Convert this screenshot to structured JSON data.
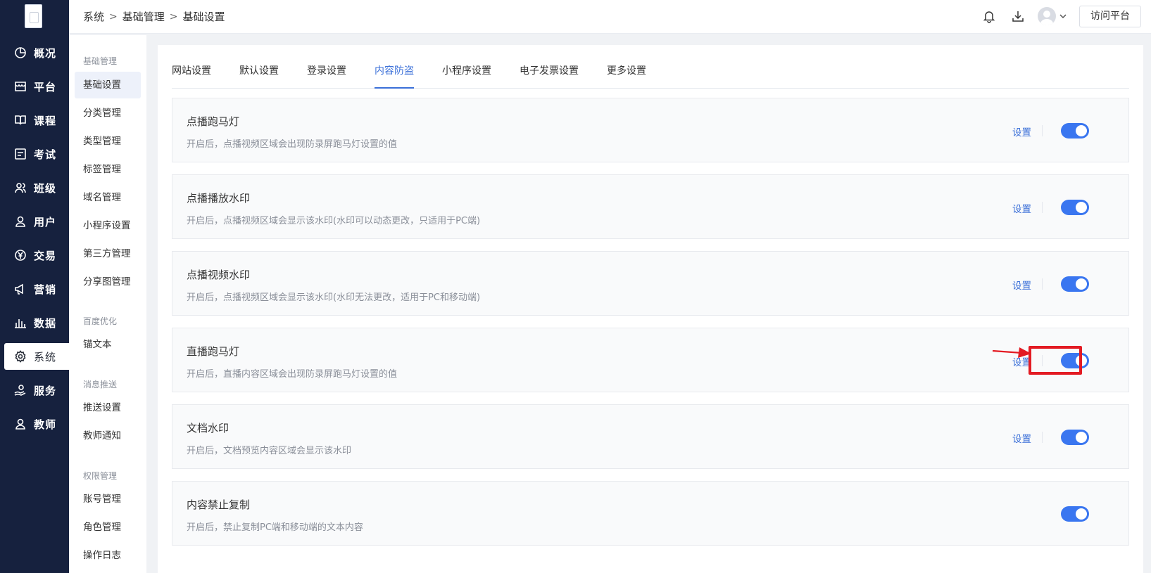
{
  "nav": {
    "items": [
      {
        "label": "概况",
        "icon": "pie-chart-icon"
      },
      {
        "label": "平台",
        "icon": "shop-icon"
      },
      {
        "label": "课程",
        "icon": "book-icon"
      },
      {
        "label": "考试",
        "icon": "exam-icon"
      },
      {
        "label": "班级",
        "icon": "class-icon"
      },
      {
        "label": "用户",
        "icon": "user-icon"
      },
      {
        "label": "交易",
        "icon": "yuan-icon"
      },
      {
        "label": "营销",
        "icon": "megaphone-icon"
      },
      {
        "label": "数据",
        "icon": "bar-chart-icon"
      },
      {
        "label": "系统",
        "icon": "gear-icon"
      },
      {
        "label": "服务",
        "icon": "service-icon"
      },
      {
        "label": "教师",
        "icon": "teacher-icon"
      }
    ]
  },
  "submenu": {
    "groups": [
      {
        "title": "基础管理",
        "items": [
          "基础设置",
          "分类管理",
          "类型管理",
          "标签管理",
          "域名管理",
          "小程序设置",
          "第三方管理",
          "分享图管理"
        ]
      },
      {
        "title": "百度优化",
        "items": [
          "锚文本"
        ]
      },
      {
        "title": "消息推送",
        "items": [
          "推送设置",
          "教师通知"
        ]
      },
      {
        "title": "权限管理",
        "items": [
          "账号管理",
          "角色管理",
          "操作日志"
        ]
      }
    ]
  },
  "header": {
    "breadcrumb": [
      "系统",
      "基础管理",
      "基础设置"
    ],
    "visit_button": "访问平台"
  },
  "tabs": [
    "网站设置",
    "默认设置",
    "登录设置",
    "内容防盗",
    "小程序设置",
    "电子发票设置",
    "更多设置"
  ],
  "active_tab": "内容防盗",
  "settings": [
    {
      "title": "点播跑马灯",
      "desc": "开启后，点播视频区域会出现防录屏跑马灯设置的值",
      "link": "设置",
      "enabled": true
    },
    {
      "title": "点播播放水印",
      "desc": "开启后，点播视频区域会显示该水印(水印可以动态更改，只适用于PC端)",
      "link": "设置",
      "enabled": true
    },
    {
      "title": "点播视频水印",
      "desc": "开启后，点播视频区域会显示该水印(水印无法更改，适用于PC和移动端)",
      "link": "设置",
      "enabled": true
    },
    {
      "title": "直播跑马灯",
      "desc": "开启后，直播内容区域会出现防录屏跑马灯设置的值",
      "link": "设置",
      "enabled": true
    },
    {
      "title": "文档水印",
      "desc": "开启后，文档预览内容区域会显示该水印",
      "link": "设置",
      "enabled": true
    },
    {
      "title": "内容禁止复制",
      "desc": "开启后，禁止复制PC端和移动端的文本内容",
      "link": "",
      "enabled": true
    }
  ],
  "colors": {
    "nav_bg": "#16213e",
    "accent": "#3a6fd8",
    "toggle_on": "#3a76f0",
    "highlight": "#e31b23"
  }
}
